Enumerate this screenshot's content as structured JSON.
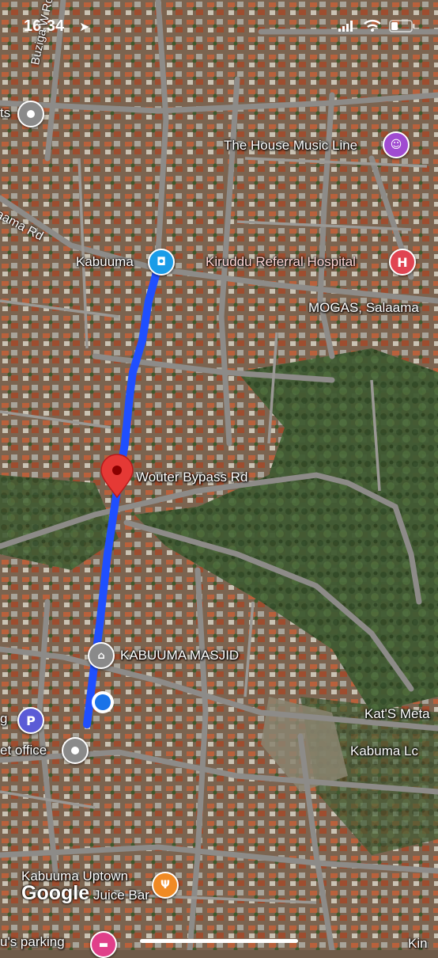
{
  "status_bar": {
    "time": "16:34"
  },
  "map": {
    "attribution": "Google",
    "places": [
      {
        "id": "kabuuma",
        "label": "Kabuuma",
        "icon": "shopping-bag-icon",
        "color": "#1a9ce8"
      },
      {
        "id": "house-music",
        "label": "The House Music Line",
        "icon": "theater-icon",
        "color": "#a04bd1"
      },
      {
        "id": "kiruddu",
        "label": "Kiruddu Referral Hospital",
        "icon": "hospital-icon",
        "color": "#e04452"
      },
      {
        "id": "mogas",
        "label": "MOGAS, Salaama",
        "icon": "",
        "color": ""
      },
      {
        "id": "masjid",
        "label": "KABUUMA MASJID",
        "icon": "mosque-icon",
        "color": "#8a8a8a"
      },
      {
        "id": "kats",
        "label": "Kat'S Meta",
        "icon": "",
        "color": ""
      },
      {
        "id": "kabuma-lc",
        "label": "Kabuma Lc",
        "icon": "",
        "color": ""
      },
      {
        "id": "uptown",
        "label": "Kabuuma Uptown",
        "icon": "restaurant-icon",
        "color": "#f08a24"
      },
      {
        "id": "juice",
        "label": "Juice Bar",
        "icon": "",
        "color": ""
      },
      {
        "id": "office",
        "label": "et office",
        "icon": "location-pin-icon",
        "color": "#8a8a8a"
      },
      {
        "id": "parking-left",
        "label": "g",
        "icon": "parking-icon",
        "color": "#5b5bd6"
      },
      {
        "id": "ts",
        "label": "ts",
        "icon": "location-pin-icon",
        "color": "#8a8a8a"
      },
      {
        "id": "parking-bottom",
        "label": "u's parking",
        "icon": "hotel-icon",
        "color": "#e0408a"
      },
      {
        "id": "kin",
        "label": "Kin",
        "icon": "",
        "color": ""
      }
    ],
    "roads": [
      {
        "id": "wouter",
        "label": "Wouter Bypass Rd"
      },
      {
        "id": "salaama",
        "label": "aama Rd"
      },
      {
        "id": "buziga",
        "label": "Buziga W Ro"
      }
    ],
    "route_color": "#1f4fff",
    "destination_color": "#e53935",
    "current_location_color": "#1a73e8"
  }
}
